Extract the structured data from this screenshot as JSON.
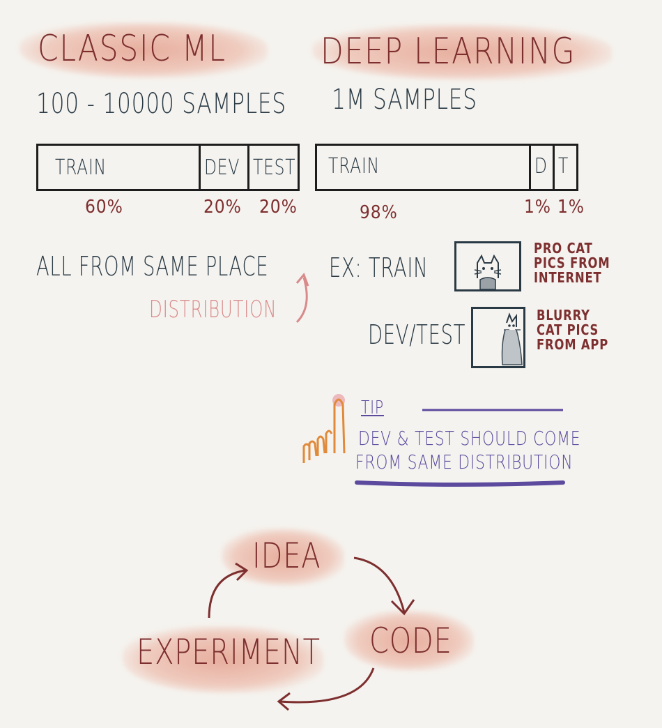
{
  "left": {
    "heading": "CLASSIC ML",
    "samples": "100 - 10000 SAMPLES",
    "bar": {
      "segments": [
        {
          "label": "TRAIN",
          "percent": "60%"
        },
        {
          "label": "DEV",
          "percent": "20%"
        },
        {
          "label": "TEST",
          "percent": "20%"
        }
      ]
    },
    "note": "ALL FROM SAME PLACE",
    "note_annotation": "DISTRIBUTION"
  },
  "right": {
    "heading": "DEEP LEARNING",
    "samples": "1M SAMPLES",
    "bar": {
      "segments": [
        {
          "label": "TRAIN",
          "percent": "98%"
        },
        {
          "label": "D",
          "percent": "1%"
        },
        {
          "label": "T",
          "percent": "1%"
        }
      ]
    },
    "example_train_label": "EX: TRAIN",
    "example_train_note": [
      "PRO CAT",
      "PICS FROM",
      "INTERNET"
    ],
    "example_devtest_label": "DEV/TEST",
    "example_devtest_note": [
      "BLURRY",
      "CAT PICS",
      "FROM APP"
    ]
  },
  "tip": {
    "title": "TIP",
    "lines": [
      "DEV & TEST SHOULD COME",
      "FROM SAME DISTRIBUTION"
    ]
  },
  "cycle": {
    "nodes": [
      "IDEA",
      "CODE",
      "EXPERIMENT"
    ]
  },
  "colors": {
    "heading": "#7d2f2f",
    "text": "#2a3a45",
    "annotation": "#d98a8a",
    "tip": "#5b4a9e",
    "highlight": "#e8a898"
  }
}
